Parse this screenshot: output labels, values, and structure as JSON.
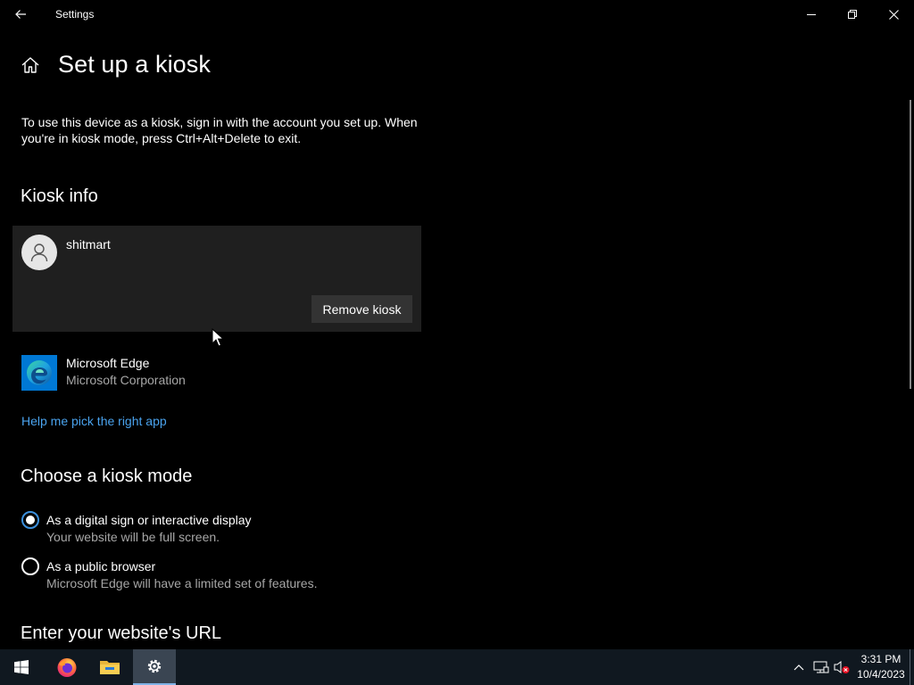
{
  "window": {
    "title": "Settings"
  },
  "page": {
    "title": "Set up a kiosk",
    "intro": "To use this device as a kiosk, sign in with the account you set up. When you're in kiosk mode, press Ctrl+Alt+Delete to exit."
  },
  "kiosk_info": {
    "heading": "Kiosk info",
    "account_name": "shitmart",
    "remove_label": "Remove kiosk",
    "app": {
      "name": "Microsoft Edge",
      "publisher": "Microsoft Corporation"
    },
    "help_link": "Help me pick the right app"
  },
  "kiosk_mode": {
    "heading": "Choose a kiosk mode",
    "options": [
      {
        "label": "As a digital sign or interactive display",
        "description": "Your website will be full screen.",
        "selected": true
      },
      {
        "label": "As a public browser",
        "description": "Microsoft Edge will have a limited set of features.",
        "selected": false
      }
    ]
  },
  "url_section": {
    "heading": "Enter your website's URL"
  },
  "taskbar": {
    "time": "3:31 PM",
    "date": "10/4/2023",
    "apps": [
      "start-icon",
      "firefox-icon",
      "file-explorer-icon",
      "settings-icon"
    ]
  },
  "colors": {
    "accent": "#3b8fdc",
    "link": "#4aa3ee",
    "card": "#1f1f1f",
    "taskbar": "#101820"
  }
}
